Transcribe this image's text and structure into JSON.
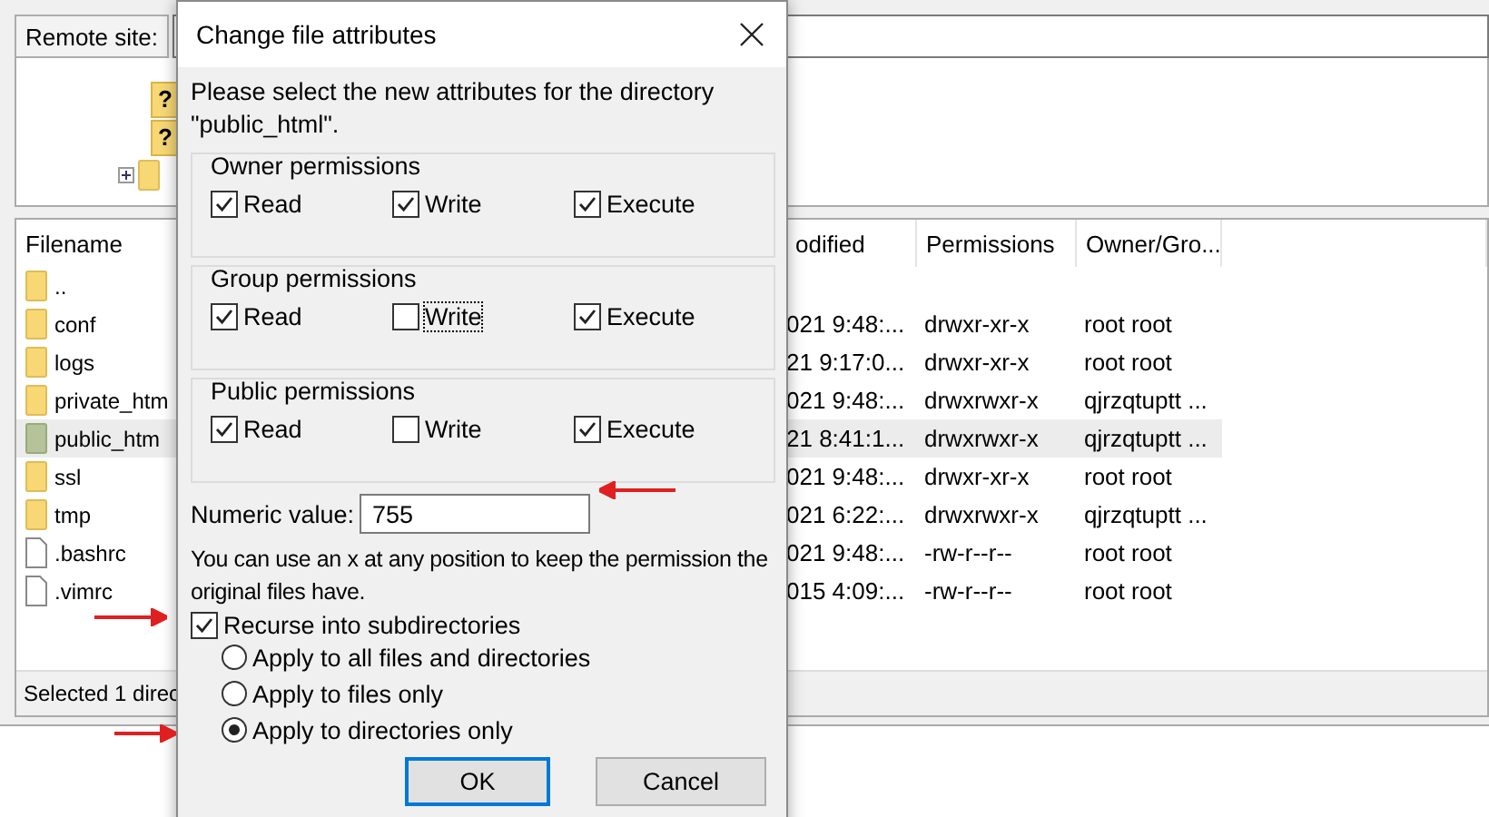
{
  "remote_site": {
    "label": "Remote site:"
  },
  "tree": [
    {
      "kind": "unknown",
      "mark": "?"
    },
    {
      "kind": "unknown",
      "mark": "?"
    },
    {
      "kind": "folder",
      "expanded": false
    }
  ],
  "file_list": {
    "columns": [
      "Filename",
      "odified",
      "Permissions",
      "Owner/Gro..."
    ],
    "rows": [
      {
        "kind": "folder",
        "name": "..",
        "selected": false
      },
      {
        "kind": "folder",
        "name": "conf",
        "modified": "021 9:48:...",
        "permissions": "drwxr-xr-x",
        "owner": "root root",
        "selected": false
      },
      {
        "kind": "folder",
        "name": "logs",
        "modified": "21 9:17:0...",
        "permissions": "drwxr-xr-x",
        "owner": "root root",
        "selected": false
      },
      {
        "kind": "folder",
        "name": "private_htm",
        "modified": "021 9:48:...",
        "permissions": "drwxrwxr-x",
        "owner": "qjrzqtuptt ...",
        "selected": false
      },
      {
        "kind": "folder",
        "name": "public_htm",
        "modified": "21 8:41:1...",
        "permissions": "drwxrwxr-x",
        "owner": "qjrzqtuptt ...",
        "selected": true
      },
      {
        "kind": "folder",
        "name": "ssl",
        "modified": "021 9:48:...",
        "permissions": "drwxr-xr-x",
        "owner": "root root",
        "selected": false
      },
      {
        "kind": "folder",
        "name": "tmp",
        "modified": "021 6:22:...",
        "permissions": "drwxrwxr-x",
        "owner": "qjrzqtuptt ...",
        "selected": false
      },
      {
        "kind": "file",
        "name": ".bashrc",
        "modified": "021 9:48:...",
        "permissions": "-rw-r--r--",
        "owner": "root root",
        "selected": false
      },
      {
        "kind": "file",
        "name": ".vimrc",
        "modified": "015 4:09:...",
        "permissions": "-rw-r--r--",
        "owner": "root root",
        "selected": false
      }
    ]
  },
  "status_bar": "Selected 1 direc",
  "dialog": {
    "title": "Change file attributes",
    "intro": "Please select the new attributes for the directory \"public_html\".",
    "groups": [
      {
        "title": "Owner permissions",
        "options": [
          {
            "label": "Read",
            "checked": true,
            "focused": false
          },
          {
            "label": "Write",
            "checked": true,
            "focused": false
          },
          {
            "label": "Execute",
            "checked": true,
            "focused": false
          }
        ]
      },
      {
        "title": "Group permissions",
        "options": [
          {
            "label": "Read",
            "checked": true,
            "focused": false
          },
          {
            "label": "Write",
            "checked": false,
            "focused": true
          },
          {
            "label": "Execute",
            "checked": true,
            "focused": false
          }
        ]
      },
      {
        "title": "Public permissions",
        "options": [
          {
            "label": "Read",
            "checked": true,
            "focused": false
          },
          {
            "label": "Write",
            "checked": false,
            "focused": false
          },
          {
            "label": "Execute",
            "checked": true,
            "focused": false
          }
        ]
      }
    ],
    "numeric": {
      "label": "Numeric value:",
      "value": "755"
    },
    "note": "You can use an x at any position to keep the permission the original files have.",
    "recurse": {
      "label": "Recurse into subdirectories",
      "checked": true
    },
    "apply": [
      {
        "label": "Apply to all files and directories",
        "selected": false
      },
      {
        "label": "Apply to files only",
        "selected": false
      },
      {
        "label": "Apply to directories only",
        "selected": true
      }
    ],
    "buttons": [
      {
        "label": "OK",
        "default": true
      },
      {
        "label": "Cancel",
        "default": false
      }
    ]
  },
  "arrows": [
    {
      "kind": "left"
    },
    {
      "kind": "right"
    },
    {
      "kind": "right"
    }
  ]
}
